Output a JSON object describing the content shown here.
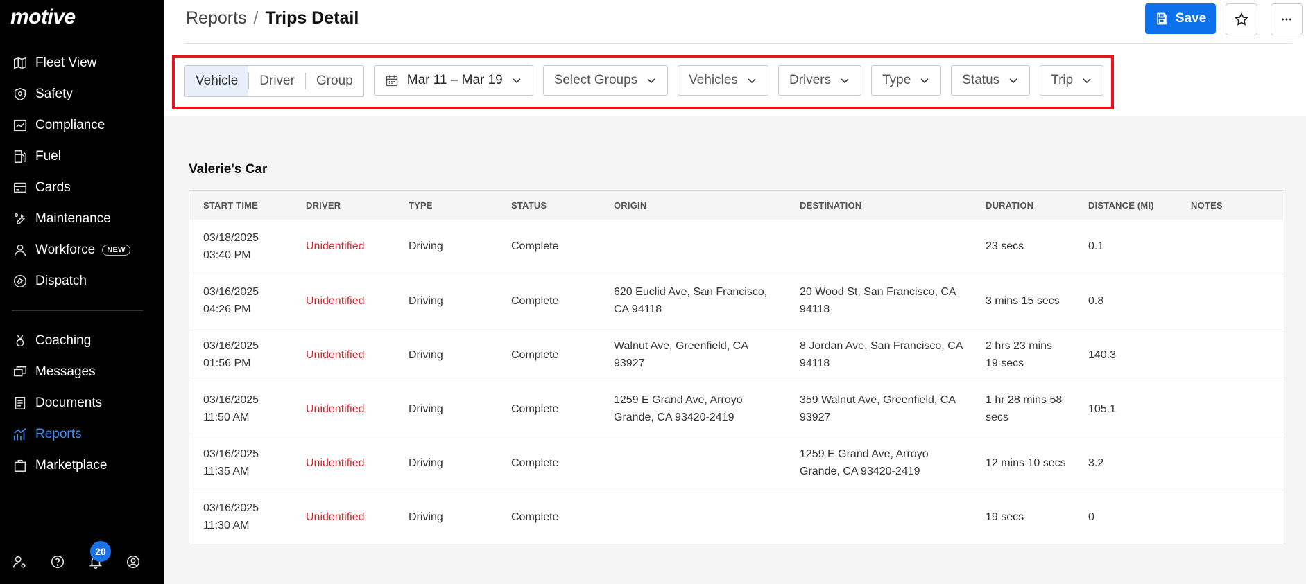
{
  "app": {
    "logo": "motive"
  },
  "sidebar": {
    "items": [
      {
        "label": "Fleet View",
        "icon": "map-icon"
      },
      {
        "label": "Safety",
        "icon": "shield-icon"
      },
      {
        "label": "Compliance",
        "icon": "chart-box-icon"
      },
      {
        "label": "Fuel",
        "icon": "fuel-pump-icon"
      },
      {
        "label": "Cards",
        "icon": "card-icon"
      },
      {
        "label": "Maintenance",
        "icon": "wrench-icon"
      },
      {
        "label": "Workforce",
        "icon": "person-icon",
        "badge": "NEW"
      },
      {
        "label": "Dispatch",
        "icon": "dispatch-icon"
      }
    ],
    "items2": [
      {
        "label": "Coaching",
        "icon": "coaching-icon"
      },
      {
        "label": "Messages",
        "icon": "messages-icon"
      },
      {
        "label": "Documents",
        "icon": "document-icon"
      },
      {
        "label": "Reports",
        "icon": "trend-icon",
        "active": true
      },
      {
        "label": "Marketplace",
        "icon": "bag-icon"
      }
    ],
    "notification_count": "20"
  },
  "header": {
    "breadcrumb_parent": "Reports",
    "breadcrumb_sep": "/",
    "breadcrumb_current": "Trips Detail",
    "save_label": "Save"
  },
  "filters": {
    "segments": [
      "Vehicle",
      "Driver",
      "Group"
    ],
    "active_segment": "Vehicle",
    "date_range": "Mar 11 – Mar 19",
    "dropdowns": [
      "Select Groups",
      "Vehicles",
      "Drivers",
      "Type",
      "Status",
      "Trip"
    ]
  },
  "section": {
    "title": "Valerie's Car"
  },
  "table": {
    "columns": [
      "START TIME",
      "DRIVER",
      "TYPE",
      "STATUS",
      "ORIGIN",
      "DESTINATION",
      "DURATION",
      "DISTANCE (MI)",
      "NOTES"
    ],
    "rows": [
      {
        "start_date": "03/18/2025",
        "start_time": "03:40 PM",
        "driver": "Unidentified",
        "type": "Driving",
        "status": "Complete",
        "origin": "",
        "destination": "",
        "duration": "23 secs",
        "distance": "0.1",
        "notes": ""
      },
      {
        "start_date": "03/16/2025",
        "start_time": "04:26 PM",
        "driver": "Unidentified",
        "type": "Driving",
        "status": "Complete",
        "origin": "620 Euclid Ave, San Francisco, CA 94118",
        "destination": "20 Wood St, San Francisco, CA 94118",
        "duration": "3 mins 15 secs",
        "distance": "0.8",
        "notes": ""
      },
      {
        "start_date": "03/16/2025",
        "start_time": "01:56 PM",
        "driver": "Unidentified",
        "type": "Driving",
        "status": "Complete",
        "origin": "Walnut Ave, Greenfield, CA 93927",
        "destination": "8 Jordan Ave, San Francisco, CA 94118",
        "duration": "2 hrs 23 mins 19 secs",
        "distance": "140.3",
        "notes": ""
      },
      {
        "start_date": "03/16/2025",
        "start_time": "11:50 AM",
        "driver": "Unidentified",
        "type": "Driving",
        "status": "Complete",
        "origin": "1259 E Grand Ave, Arroyo Grande, CA 93420-2419",
        "destination": "359 Walnut Ave, Greenfield, CA 93927",
        "duration": "1 hr 28 mins 58 secs",
        "distance": "105.1",
        "notes": ""
      },
      {
        "start_date": "03/16/2025",
        "start_time": "11:35 AM",
        "driver": "Unidentified",
        "type": "Driving",
        "status": "Complete",
        "origin": "",
        "destination": "1259 E Grand Ave, Arroyo Grande, CA 93420-2419",
        "duration": "12 mins 10 secs",
        "distance": "3.2",
        "notes": ""
      },
      {
        "start_date": "03/16/2025",
        "start_time": "11:30 AM",
        "driver": "Unidentified",
        "type": "Driving",
        "status": "Complete",
        "origin": "",
        "destination": "",
        "duration": "19 secs",
        "distance": "0",
        "notes": ""
      }
    ]
  },
  "colors": {
    "accent": "#0e71ec",
    "active_nav": "#3d8ef7",
    "highlight_frame": "#e2141d",
    "driver_text": "#d7262b"
  }
}
